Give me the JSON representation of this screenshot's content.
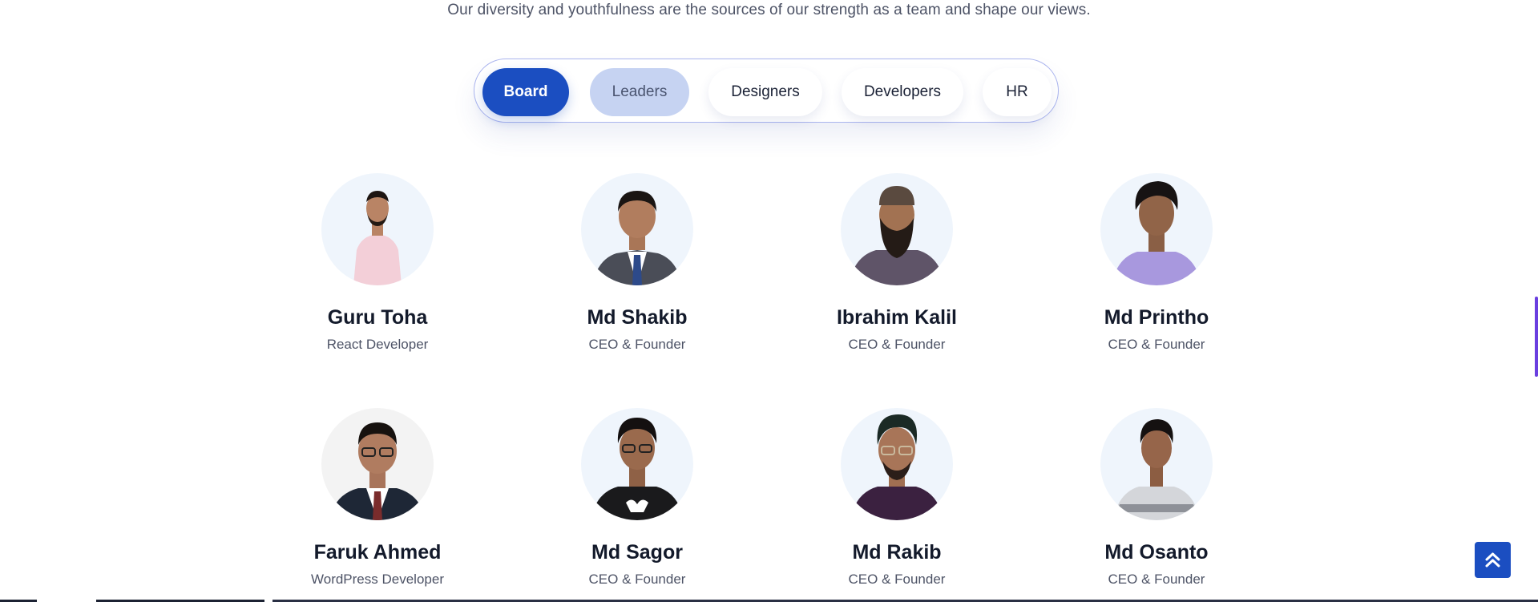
{
  "intro": {
    "subtitle": "Our diversity and youthfulness are the sources of our strength as a team and shape our views."
  },
  "tabs": [
    {
      "label": "Board",
      "state": "active"
    },
    {
      "label": "Leaders",
      "state": "hover"
    },
    {
      "label": "Designers",
      "state": "default"
    },
    {
      "label": "Developers",
      "state": "default"
    },
    {
      "label": "HR",
      "state": "default"
    }
  ],
  "team": [
    {
      "name": "Guru Toha",
      "role": "React Developer"
    },
    {
      "name": "Md Shakib",
      "role": "CEO & Founder"
    },
    {
      "name": "Ibrahim Kalil",
      "role": "CEO & Founder"
    },
    {
      "name": "Md Printho",
      "role": "CEO & Founder"
    },
    {
      "name": "Faruk Ahmed",
      "role": "WordPress Developer"
    },
    {
      "name": "Md Sagor",
      "role": "CEO & Founder"
    },
    {
      "name": "Md Rakib",
      "role": "CEO & Founder"
    },
    {
      "name": "Md Osanto",
      "role": "CEO & Founder"
    }
  ],
  "scroll_top": {
    "icon": "double-chevron-up-icon"
  },
  "colors": {
    "accent": "#1b4ec1",
    "tab_hover": "#c6d3f2",
    "avatar_bg": "#eff5fc",
    "scroll_indicator": "#6a3fe0"
  }
}
